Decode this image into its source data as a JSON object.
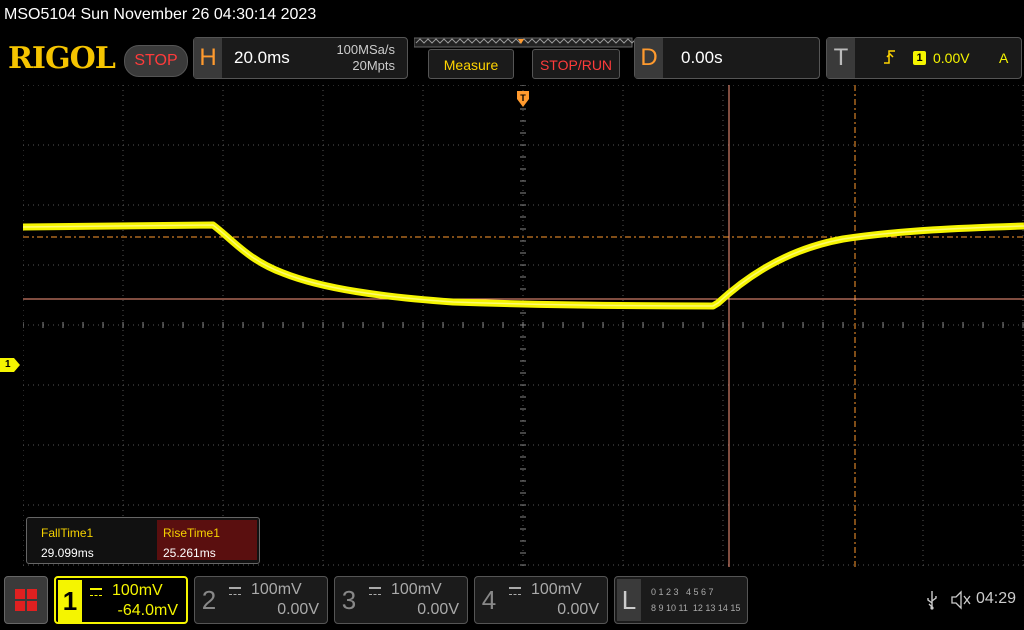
{
  "title_bar": {
    "text": "MSO5104  Sun November 26 04:30:14 2023"
  },
  "brand": {
    "logo": "RIGOL",
    "run_state": "STOP"
  },
  "horizontal": {
    "letter": "H",
    "timebase": "20.0ms",
    "sample_rate": "100MSa/s",
    "memory_depth": "20Mpts"
  },
  "buttons": {
    "measure": "Measure",
    "stop_run": "STOP/RUN"
  },
  "delay": {
    "letter": "D",
    "value": "0.00s"
  },
  "trigger": {
    "letter": "T",
    "source": "1",
    "level": "0.00V",
    "mode": "A"
  },
  "channel_marker": "1",
  "measurements": {
    "fall_label": "FallTime1",
    "fall_value": "29.099ms",
    "rise_label": "RiseTime1",
    "rise_value": "25.261ms"
  },
  "channels": [
    {
      "num": "1",
      "scale": "100mV",
      "offset": "-64.0mV",
      "active": true
    },
    {
      "num": "2",
      "scale": "100mV",
      "offset": "0.00V",
      "active": false
    },
    {
      "num": "3",
      "scale": "100mV",
      "offset": "0.00V",
      "active": false
    },
    {
      "num": "4",
      "scale": "100mV",
      "offset": "0.00V",
      "active": false
    }
  ],
  "logic": {
    "letter": "L",
    "row1": "0 1 2 3   4 5 6 7",
    "row2": "8 9 10 11  12 13 14 15"
  },
  "status": {
    "time": "04:29"
  },
  "colors": {
    "ch1": "#f5f500",
    "cursor": "#ff9a80",
    "accent": "#ff9a2e",
    "brand": "#f5c400"
  }
}
